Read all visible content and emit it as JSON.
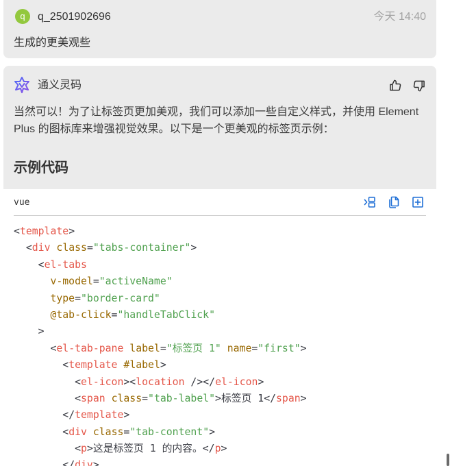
{
  "theme": {
    "accent": "#1f6fd6",
    "user_avatar_bg": "#93c83e",
    "card_bg": "#ebebeb"
  },
  "user_message": {
    "avatar_letter": "q",
    "username": "q_2501902696",
    "timestamp": "今天 14:40",
    "text": "生成的更美观些"
  },
  "assistant_message": {
    "avatar_icon": "tongyi-lingma-logo-icon",
    "name": "通义灵码",
    "feedback": {
      "like_icon": "thumbs-up-icon",
      "dislike_icon": "thumbs-down-icon"
    },
    "intro": "当然可以！为了让标签页更加美观，我们可以添加一些自定义样式，并使用 Element Plus 的图标库来增强视觉效果。以下是一个更美观的标签页示例：",
    "heading": "示例代码",
    "code_block": {
      "language": "vue",
      "actions": [
        {
          "icon": "insert-code-icon"
        },
        {
          "icon": "copy-icon"
        },
        {
          "icon": "new-file-icon"
        }
      ],
      "lines": [
        "<template>",
        "  <div class=\"tabs-container\">",
        "    <el-tabs",
        "      v-model=\"activeName\"",
        "      type=\"border-card\"",
        "      @tab-click=\"handleTabClick\"",
        "    >",
        "      <el-tab-pane label=\"标签页 1\" name=\"first\">",
        "        <template #label>",
        "          <el-icon><location /></el-icon>",
        "          <span class=\"tab-label\">标签页 1</span>",
        "        </template>",
        "        <div class=\"tab-content\">",
        "          <p>这是标签页 1 的内容。</p>",
        "        </div>"
      ]
    }
  }
}
